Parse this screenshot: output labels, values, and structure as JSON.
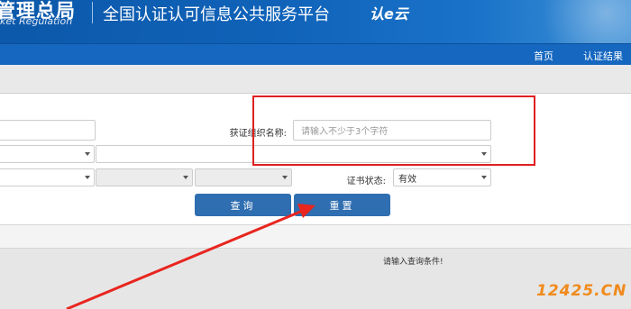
{
  "header": {
    "brand_cn": "管理总局",
    "brand_en": "ket Regulation",
    "site_title": "全国认证认可信息公共服务平台",
    "logo_text": "认e云"
  },
  "nav": {
    "items": [
      "首页",
      "认证结果"
    ]
  },
  "form": {
    "org_label": "获证组织名称:",
    "org_placeholder": "请输入不少于3个字符",
    "status_label": "证书状态:",
    "status_value": "有效",
    "query_button": "查询",
    "reset_button": "重置"
  },
  "results": {
    "message": "请输入查询条件!"
  },
  "watermark": "12425.CN",
  "colors": {
    "header_blue": "#1063b9",
    "button_blue": "#2f6eb0",
    "annotation_red": "#e02020",
    "watermark_orange": "#f08a1c"
  }
}
